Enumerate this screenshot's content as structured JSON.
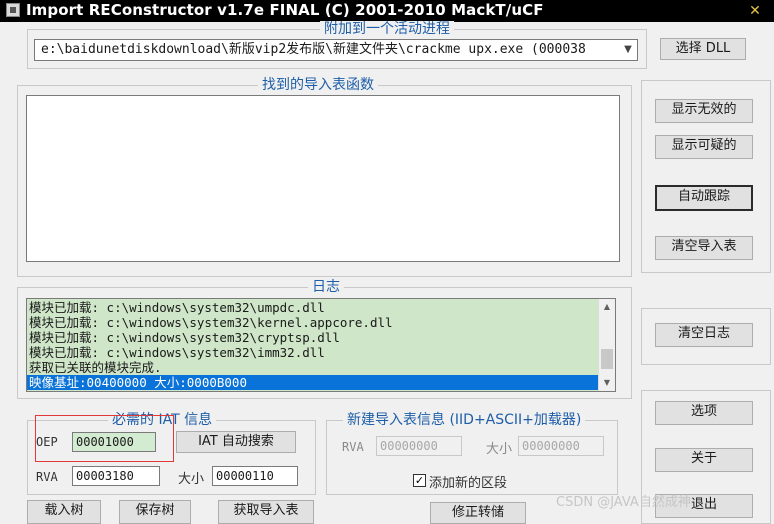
{
  "window": {
    "title": "Import REConstructor v1.7e FINAL (C) 2001-2010 MackT/uCF"
  },
  "attach": {
    "group_title": "附加到一个活动进程",
    "process_value": "e:\\baidunetdiskdownload\\新版vip2发布版\\新建文件夹\\crackme upx.exe (000038",
    "pick_dll_label": "选择 DLL"
  },
  "imports": {
    "group_title": "找到的导入表函数",
    "items": []
  },
  "right_panel": {
    "show_invalid_label": "显示无效的",
    "show_suspect_label": "显示可疑的",
    "auto_trace_label": "自动跟踪",
    "clear_imports_label": "清空导入表",
    "clear_log_label": "清空日志",
    "options_label": "选项",
    "about_label": "关于",
    "exit_label": "退出"
  },
  "log": {
    "group_title": "日志",
    "lines": [
      "模块已加载: c:\\windows\\system32\\umpdc.dll",
      "模块已加载: c:\\windows\\system32\\kernel.appcore.dll",
      "模块已加载: c:\\windows\\system32\\cryptsp.dll",
      "模块已加载: c:\\windows\\system32\\imm32.dll",
      "获取已关联的模块完成.",
      "映像基址:00400000 大小:0000B000"
    ]
  },
  "iat_info": {
    "group_title": "必需的 IAT 信息",
    "oep_label": "OEP",
    "oep_value": "00001000",
    "autosearch_label": "IAT 自动搜索",
    "rva_label": "RVA",
    "rva_value": "00003180",
    "size_label": "大小",
    "size_value": "00000110"
  },
  "new_import_info": {
    "group_title": "新建导入表信息 (IID+ASCII+加载器)",
    "rva_label": "RVA",
    "rva_value": "00000000",
    "size_label": "大小",
    "size_value": "00000000",
    "add_section_label": "添加新的区段",
    "add_section_checked": "✓"
  },
  "bottom_buttons": {
    "load_tree_label": "载入树",
    "save_tree_label": "保存树",
    "get_imports_label": "获取导入表",
    "fix_dump_label": "修正转储"
  },
  "watermark": {
    "text": "CSDN @JAVA自然成神"
  },
  "colors": {
    "group_title": "#1e5ea8",
    "log_bg": "#cfe6c8",
    "selection": "#0a73d9",
    "highlight_box": "#e03a3a"
  }
}
